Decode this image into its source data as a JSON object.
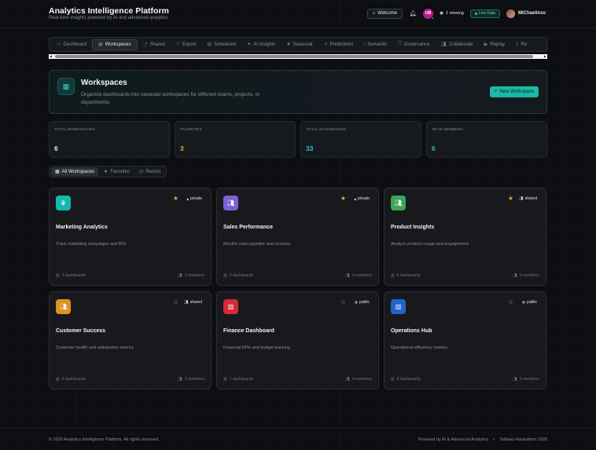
{
  "header": {
    "title": "Analytics Intelligence Platform",
    "subtitle": "Real-time insights powered by AI and advanced analytics",
    "welcome_label": "Welcome",
    "avatar_initials": "UB",
    "viewing_label": "1 viewing",
    "live_label": "Live Data",
    "user_name": "MiChaelinzo"
  },
  "tabs": [
    {
      "label": "Dashboard",
      "icon": "dashboard-icon"
    },
    {
      "label": "Workspaces",
      "icon": "grid-icon",
      "active": true
    },
    {
      "label": "Shared",
      "icon": "share-icon"
    },
    {
      "label": "Export",
      "icon": "export-icon"
    },
    {
      "label": "Scheduled",
      "icon": "calendar-icon"
    },
    {
      "label": "AI Insights",
      "icon": "sparkle-icon"
    },
    {
      "label": "Seasonal",
      "icon": "leaf-icon"
    },
    {
      "label": "Predictions",
      "icon": "trend-icon"
    },
    {
      "label": "Semantic",
      "icon": "wand-icon"
    },
    {
      "label": "Governance",
      "icon": "shield-icon"
    },
    {
      "label": "Collaborate",
      "icon": "users-icon"
    },
    {
      "label": "Replay",
      "icon": "video-icon"
    },
    {
      "label": "Re",
      "icon": "doc-icon"
    }
  ],
  "hero": {
    "title": "Workspaces",
    "description": "Organize dashboards into separate workspaces for different teams, projects, or departments",
    "new_button": "New Workspace"
  },
  "stats": [
    {
      "label": "TOTAL WORKSPACES",
      "value": "6",
      "color": "#e6e8eb"
    },
    {
      "label": "FAVORITES",
      "value": "3",
      "color": "#f0a23a"
    },
    {
      "label": "TOTAL DASHBOARDS",
      "value": "33",
      "color": "#2ec4d6"
    },
    {
      "label": "TEAM MEMBERS",
      "value": "6",
      "color": "#3fc47a"
    }
  ],
  "filters": [
    {
      "label": "All Workspaces",
      "active": true
    },
    {
      "label": "Favorites"
    },
    {
      "label": "Recent"
    }
  ],
  "workspaces": [
    {
      "title": "Marketing Analytics",
      "description": "Track marketing campaigns and ROI",
      "visibility": "private",
      "favorite": true,
      "dashboards": "3 dashboards",
      "members": "3 members",
      "color": "#14b8b0",
      "icon": "crown-icon"
    },
    {
      "title": "Sales Performance",
      "description": "Monitor sales pipeline and revenue",
      "visibility": "private",
      "favorite": true,
      "dashboards": "4 dashboards",
      "members": "4 members",
      "color": "#7c5fd6",
      "icon": "users-icon"
    },
    {
      "title": "Product Insights",
      "description": "Analyze product usage and engagement",
      "visibility": "shared",
      "favorite": true,
      "dashboards": "5 dashboards",
      "members": "5 members",
      "color": "#3aa858",
      "icon": "users-icon"
    },
    {
      "title": "Customer Success",
      "description": "Customer health and satisfaction metrics",
      "visibility": "shared",
      "favorite": false,
      "dashboards": "6 dashboards",
      "members": "3 members",
      "color": "#e0921e",
      "icon": "users-icon"
    },
    {
      "title": "Finance Dashboard",
      "description": "Financial KPIs and budget tracking",
      "visibility": "public",
      "favorite": false,
      "dashboards": "7 dashboards",
      "members": "4 members",
      "color": "#d42a3a",
      "icon": "building-icon"
    },
    {
      "title": "Operations Hub",
      "description": "Operational efficiency metrics",
      "visibility": "public",
      "favorite": false,
      "dashboards": "8 dashboards",
      "members": "5 members",
      "color": "#2563c9",
      "icon": "building-icon"
    }
  ],
  "footer": {
    "copyright": "© 2026 Analytics Intelligence Platform. All rights reserved.",
    "powered": "Powered by AI & Advanced Analytics",
    "separator": "•",
    "event": "Tableau Hackathon 2026"
  }
}
